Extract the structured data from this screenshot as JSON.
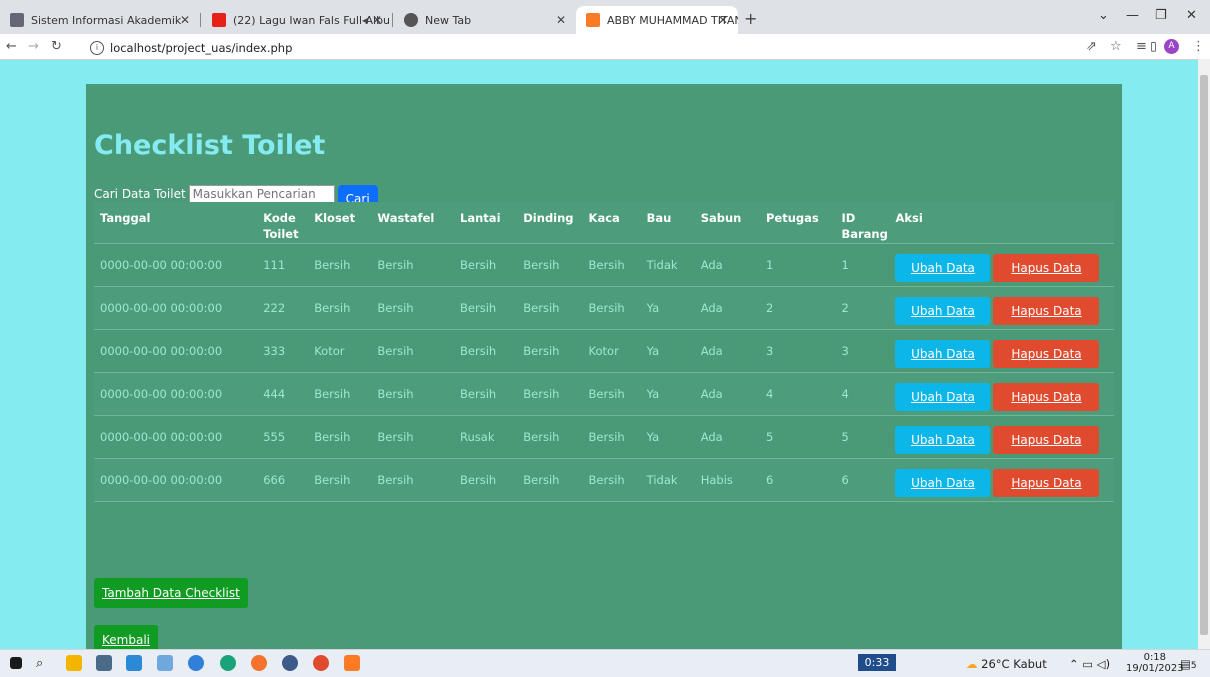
{
  "browser": {
    "tabs": [
      {
        "title": "Sistem Informasi Akademik",
        "icon": "graduation-icon",
        "color": "#556"
      },
      {
        "title": "(22) Lagu Iwan Fals Full Albu",
        "icon": "youtube-icon",
        "color": "#e62117"
      },
      {
        "title": "New Tab",
        "icon": "chrome-icon",
        "color": "#555"
      },
      {
        "title": "ABBY MUHAMMAD TITAN",
        "icon": "xampp-icon",
        "color": "#fb7a24"
      }
    ],
    "url": "localhost/project_uas/index.php",
    "avatar_letter": "A"
  },
  "page": {
    "title": "Checklist Toilet",
    "search_label": "Cari Data Toilet",
    "search_placeholder": "Masukkan Pencarian",
    "search_button": "Cari",
    "columns": [
      "Tanggal",
      "Kode Toilet",
      "Kloset",
      "Wastafel",
      "Lantai",
      "Dinding",
      "Kaca",
      "Bau",
      "Sabun",
      "Petugas",
      "ID Barang",
      "Aksi"
    ],
    "rows": [
      {
        "tanggal": "0000-00-00 00:00:00",
        "kode": "111",
        "kloset": "Bersih",
        "wastafel": "Bersih",
        "lantai": "Bersih",
        "dinding": "Bersih",
        "kaca": "Bersih",
        "bau": "Tidak",
        "sabun": "Ada",
        "petugas": "1",
        "id_barang": "1"
      },
      {
        "tanggal": "0000-00-00 00:00:00",
        "kode": "222",
        "kloset": "Bersih",
        "wastafel": "Bersih",
        "lantai": "Bersih",
        "dinding": "Bersih",
        "kaca": "Bersih",
        "bau": "Ya",
        "sabun": "Ada",
        "petugas": "2",
        "id_barang": "2"
      },
      {
        "tanggal": "0000-00-00 00:00:00",
        "kode": "333",
        "kloset": "Kotor",
        "wastafel": "Bersih",
        "lantai": "Bersih",
        "dinding": "Bersih",
        "kaca": "Kotor",
        "bau": "Ya",
        "sabun": "Ada",
        "petugas": "3",
        "id_barang": "3"
      },
      {
        "tanggal": "0000-00-00 00:00:00",
        "kode": "444",
        "kloset": "Bersih",
        "wastafel": "Bersih",
        "lantai": "Bersih",
        "dinding": "Bersih",
        "kaca": "Bersih",
        "bau": "Ya",
        "sabun": "Ada",
        "petugas": "4",
        "id_barang": "4"
      },
      {
        "tanggal": "0000-00-00 00:00:00",
        "kode": "555",
        "kloset": "Bersih",
        "wastafel": "Bersih",
        "lantai": "Rusak",
        "dinding": "Bersih",
        "kaca": "Bersih",
        "bau": "Ya",
        "sabun": "Ada",
        "petugas": "5",
        "id_barang": "5"
      },
      {
        "tanggal": "0000-00-00 00:00:00",
        "kode": "666",
        "kloset": "Bersih",
        "wastafel": "Bersih",
        "lantai": "Bersih",
        "dinding": "Bersih",
        "kaca": "Bersih",
        "bau": "Tidak",
        "sabun": "Habis",
        "petugas": "6",
        "id_barang": "6"
      }
    ],
    "edit_label": "Ubah Data",
    "delete_label": "Hapus Data",
    "add_label": "Tambah Data Checklist",
    "back_label": "Kembali"
  },
  "taskbar": {
    "timer": "0:33",
    "weather": "26°C Kabut",
    "time": "0:18",
    "date": "19/01/2023",
    "notifications": "5"
  },
  "colors": {
    "page_bg": "#84ecf0",
    "container_bg": "#4a9a78",
    "title": "#84ecf0",
    "edit_button": "#0db6e8",
    "delete_button": "#e04a2e",
    "green_button": "#109b22",
    "search_button": "#0d6efd"
  }
}
